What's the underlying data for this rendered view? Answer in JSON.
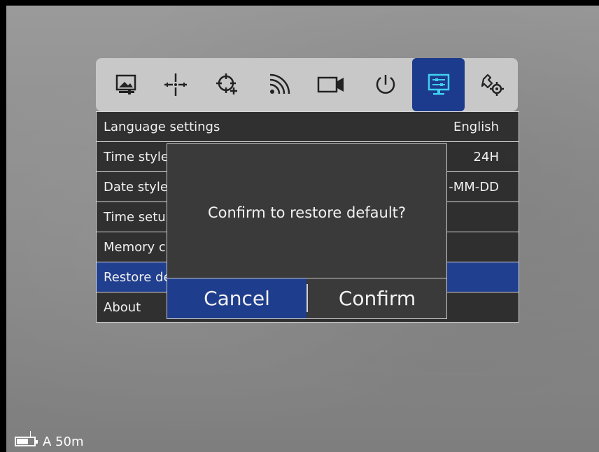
{
  "toolbar": {
    "icons": [
      {
        "name": "image-settings-icon",
        "active": false
      },
      {
        "name": "crosshair-icon",
        "active": false
      },
      {
        "name": "target-add-icon",
        "active": false
      },
      {
        "name": "wireless-icon",
        "active": false
      },
      {
        "name": "video-record-icon",
        "active": false
      },
      {
        "name": "power-icon",
        "active": false
      },
      {
        "name": "display-settings-icon",
        "active": true
      },
      {
        "name": "wrench-gear-icon",
        "active": false
      }
    ]
  },
  "menu": {
    "rows": [
      {
        "label": "Language settings",
        "value": "English",
        "selected": false
      },
      {
        "label": "Time style",
        "value": "24H",
        "selected": false
      },
      {
        "label": "Date style",
        "value": "-MM-DD",
        "selected": false
      },
      {
        "label": "Time setu",
        "value": "",
        "selected": false
      },
      {
        "label": "Memory c",
        "value": "",
        "selected": false
      },
      {
        "label": "Restore de",
        "value": "",
        "selected": true
      },
      {
        "label": "About",
        "value": "",
        "selected": false
      }
    ]
  },
  "dialog": {
    "message": "Confirm to restore default?",
    "cancel_label": "Cancel",
    "confirm_label": "Confirm"
  },
  "status": {
    "mode_range": "A 50m"
  },
  "colors": {
    "accent": "#1f3d8d",
    "toolbar_bg": "#c8c8c8",
    "row_bg": "#282828"
  }
}
